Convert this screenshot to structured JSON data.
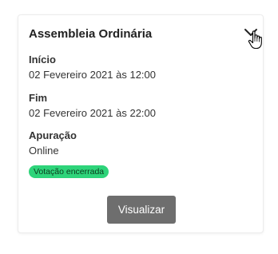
{
  "card": {
    "title": "Assembleia Ordinária",
    "toggle_icon": "chevron-down-icon",
    "cursor_icon": "hand-pointer-icon",
    "fields": [
      {
        "label": "Início",
        "value": "02 Fevereiro 2021 às 12:00"
      },
      {
        "label": "Fim",
        "value": "02 Fevereiro 2021 às 22:00"
      },
      {
        "label": "Apuração",
        "value": "Online"
      }
    ],
    "status_badge": {
      "text": "Votação encerrada",
      "color": "#2ed47a"
    },
    "view_button": {
      "label": "Visualizar",
      "color": "#6e6e6e"
    }
  }
}
